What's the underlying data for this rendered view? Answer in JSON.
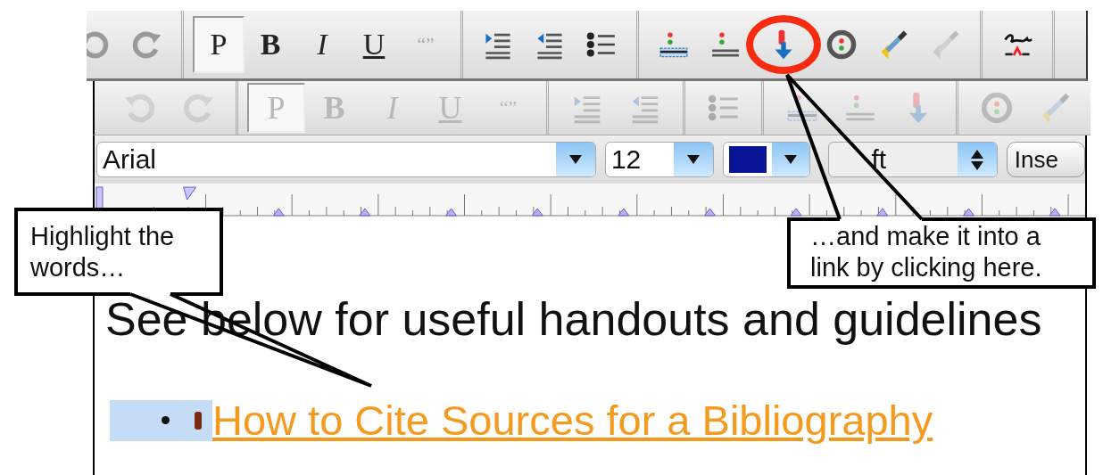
{
  "top_toolbar": {
    "disabled": false,
    "groups": [
      [
        {
          "kind": "undo",
          "pressed": false,
          "circled": false
        },
        {
          "kind": "redo",
          "pressed": false,
          "circled": false
        }
      ],
      [
        {
          "kind": "paragraph",
          "label": "P",
          "pressed": true,
          "circled": false
        },
        {
          "kind": "bold",
          "label": "B",
          "pressed": false,
          "circled": false
        },
        {
          "kind": "italic",
          "label": "I",
          "pressed": false,
          "circled": false
        },
        {
          "kind": "underline",
          "label": "U",
          "pressed": false,
          "circled": false
        },
        {
          "kind": "quote",
          "label": "“”",
          "pressed": false,
          "circled": false
        }
      ],
      [
        {
          "kind": "indent",
          "pressed": false,
          "circled": false
        },
        {
          "kind": "outdent",
          "pressed": false,
          "circled": false
        },
        {
          "kind": "list",
          "pressed": false,
          "circled": false
        }
      ],
      [
        {
          "kind": "rule",
          "pressed": false,
          "circled": false
        },
        {
          "kind": "lines",
          "pressed": false,
          "circled": false
        },
        {
          "kind": "link",
          "pressed": false,
          "circled": true
        },
        {
          "kind": "ring",
          "pressed": false,
          "circled": false
        },
        {
          "kind": "dropper",
          "pressed": false,
          "circled": false
        },
        {
          "kind": "dropper-off",
          "pressed": false,
          "circled": false
        }
      ],
      [
        {
          "kind": "signature",
          "pressed": false,
          "circled": false
        }
      ]
    ]
  },
  "editor": {
    "toolbar": {
      "disabled": true,
      "groups": [
        [
          {
            "kind": "undo",
            "pressed": false,
            "circled": false
          },
          {
            "kind": "redo",
            "pressed": false,
            "circled": false
          }
        ],
        [
          {
            "kind": "paragraph",
            "label": "P",
            "pressed": true,
            "circled": false
          },
          {
            "kind": "bold",
            "label": "B",
            "pressed": false,
            "circled": false
          },
          {
            "kind": "italic",
            "label": "I",
            "pressed": false,
            "circled": false
          },
          {
            "kind": "underline",
            "label": "U",
            "pressed": false,
            "circled": false
          },
          {
            "kind": "quote",
            "label": "“”",
            "pressed": false,
            "circled": false
          }
        ],
        [
          {
            "kind": "indent",
            "pressed": false,
            "circled": false
          },
          {
            "kind": "outdent",
            "pressed": false,
            "circled": false
          }
        ],
        [
          {
            "kind": "list",
            "pressed": false,
            "circled": false
          }
        ],
        [
          {
            "kind": "rule",
            "pressed": false,
            "circled": false
          },
          {
            "kind": "lines",
            "pressed": false,
            "circled": false
          },
          {
            "kind": "link",
            "pressed": false,
            "circled": false
          }
        ],
        [
          {
            "kind": "ring",
            "pressed": false,
            "circled": false
          },
          {
            "kind": "dropper",
            "pressed": false,
            "circled": false
          }
        ]
      ]
    },
    "font_family": {
      "value": "Arial"
    },
    "font_size": {
      "value": "12"
    },
    "text_color": {
      "color": "#0a1496"
    },
    "alignment": {
      "value": "ft"
    },
    "insert_button": {
      "label": "Inse"
    },
    "heading": "See below for useful handouts and guidelines",
    "list": [
      {
        "text": "How to Cite Sources for a Bibliography",
        "selected": true
      }
    ]
  },
  "callouts": [
    {
      "text": "Highlight the words…"
    },
    {
      "text": "…and make it into a link by clicking here."
    }
  ]
}
